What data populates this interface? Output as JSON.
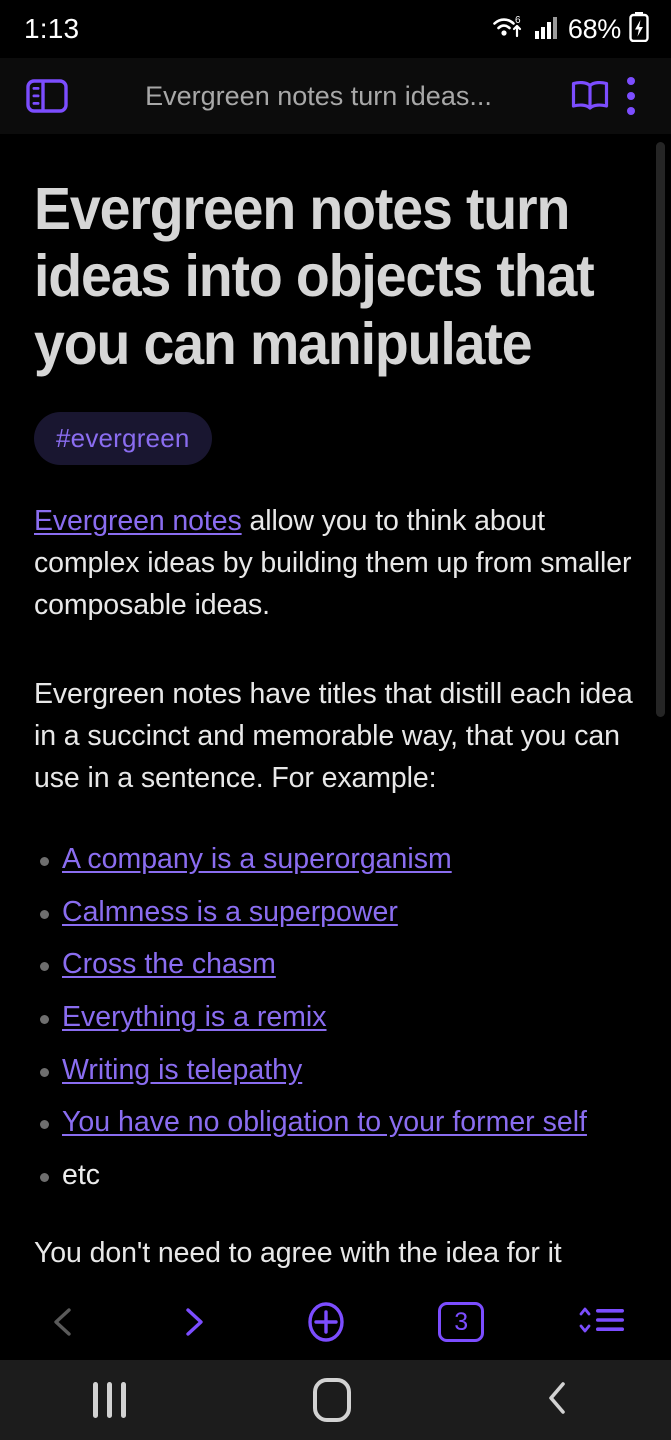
{
  "status_bar": {
    "time": "1:13",
    "battery_percent": "68%",
    "wifi_icon": "wifi-6-icon",
    "signal_icon": "cellular-signal-icon",
    "battery_icon": "battery-charging-icon"
  },
  "top_bar": {
    "sidebar_toggle_icon": "sidebar-panel-icon",
    "title": "Evergreen notes turn ideas...",
    "reader_icon": "open-book-icon",
    "overflow_icon": "kebab-menu-icon"
  },
  "content": {
    "doc_title": "Evergreen notes turn ideas into objects that you can manipulate",
    "tag": "#evergreen",
    "paragraph_1": {
      "link_text": "Evergreen notes",
      "rest": " allow you to think about complex ideas by building them up from smaller composable ideas."
    },
    "paragraph_2": "Evergreen notes have titles that distill each idea in a succinct and memorable way, that you can use in a sentence. For example:",
    "bullets": [
      {
        "text": "A company is a superorganism",
        "is_link": true
      },
      {
        "text": "Calmness is a superpower",
        "is_link": true
      },
      {
        "text": "Cross the chasm",
        "is_link": true
      },
      {
        "text": "Everything is a remix",
        "is_link": true
      },
      {
        "text": "Writing is telepathy",
        "is_link": true
      },
      {
        "text": "You have no obligation to your former self",
        "is_link": true
      },
      {
        "text": "etc",
        "is_link": false
      }
    ],
    "paragraph_3_clipped": "You don't need to agree with the idea for it"
  },
  "bottom_bar": {
    "back_icon": "chevron-left-icon",
    "forward_icon": "chevron-right-icon",
    "new_tab_icon": "plus-circle-icon",
    "tab_count": "3",
    "sort_icon": "sort-list-icon"
  },
  "nav_bar": {
    "recents_icon": "recents-icon",
    "home_icon": "home-icon",
    "back_icon": "android-back-icon"
  },
  "colors": {
    "background": "#000000",
    "accent_purple": "#7c4dff",
    "link_purple": "#8a6df0",
    "tag_background": "#191630",
    "title_text": "#d6d6d6",
    "body_text": "#e8e8e8",
    "topbar_title_text": "#a8a8a8",
    "navbar_background": "#1c1c1c"
  }
}
